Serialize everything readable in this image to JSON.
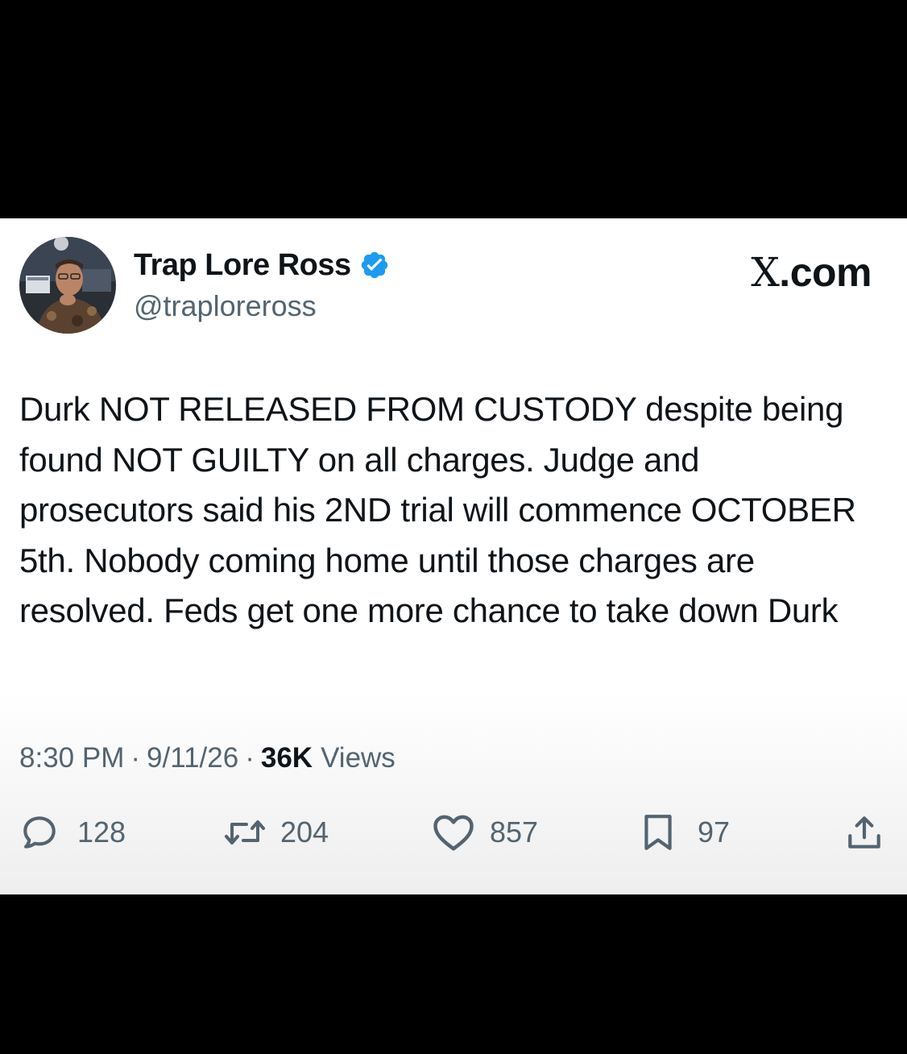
{
  "tweet": {
    "author": {
      "display_name": "Trap Lore Ross",
      "handle": "@traploreross",
      "verified": true,
      "badge_color": "#1d9bf0"
    },
    "brand": {
      "x_letter": "X",
      "domain_suffix": ".com"
    },
    "text": "Durk NOT RELEASED FROM CUSTODY despite being found NOT GUILTY on all charges. Judge and prosecutors said his 2ND trial will commence OCTOBER 5th. Nobody coming home until those charges are resolved. Feds get one more chance to take down Durk",
    "time": "8:30 PM",
    "date": "9/11/26",
    "views_count": "36K",
    "views_label": "Views",
    "separator": "·"
  },
  "actions": {
    "replies": {
      "icon": "reply-icon",
      "count": "128"
    },
    "retweets": {
      "icon": "retweet-icon",
      "count": "204"
    },
    "likes": {
      "icon": "heart-icon",
      "count": "857"
    },
    "bookmarks": {
      "icon": "bookmark-icon",
      "count": "97"
    },
    "share": {
      "icon": "share-icon"
    }
  },
  "colors": {
    "text_primary": "#0f1419",
    "text_secondary": "#536471",
    "background": "#000000"
  }
}
